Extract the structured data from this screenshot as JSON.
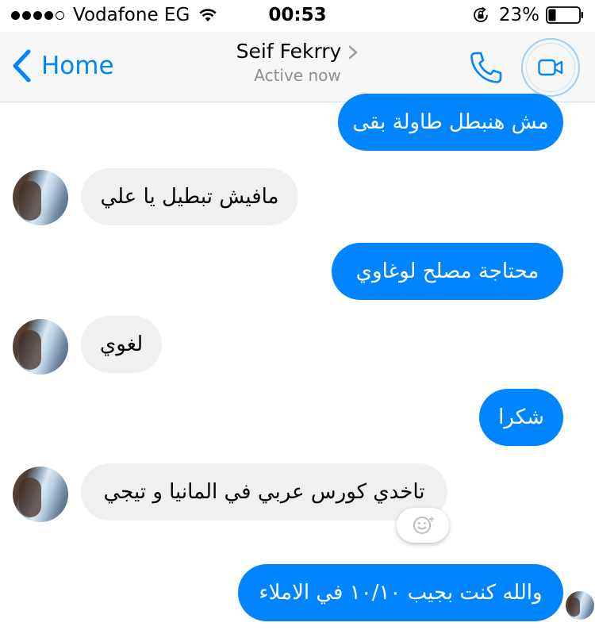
{
  "status_bar": {
    "carrier": "Vodafone EG",
    "time": "00:53",
    "battery": "23%",
    "signal_dots_filled": 4,
    "signal_dots_total": 5
  },
  "nav": {
    "back_label": "Home",
    "contact_name": "Seif Fekrry",
    "status": "Active now"
  },
  "icons": {
    "back": "chevron-left-icon",
    "phone": "phone-icon",
    "video": "video-camera-icon",
    "wifi": "wifi-icon",
    "lock": "rotation-lock-icon",
    "battery": "battery-icon",
    "reaction": "emoji-reaction-icon"
  },
  "colors": {
    "accent": "#0084ff",
    "incoming_bubble": "#f1f0f0",
    "outgoing_text": "#ffffff"
  },
  "messages": [
    {
      "direction": "out",
      "text": "مش هنبطل طاولة بقى"
    },
    {
      "direction": "in",
      "text": "مافيش تبطيل يا علي"
    },
    {
      "direction": "out",
      "text": "محتاجة مصلح لوغاوي"
    },
    {
      "direction": "in",
      "text": "لغوي"
    },
    {
      "direction": "out",
      "text": "شكرا"
    },
    {
      "direction": "in",
      "text": "تاخدي كورس عربي في المانيا و تيجي"
    },
    {
      "direction": "out",
      "text": "والله كنت بجيب ١٠/١٠ في الاملاء"
    }
  ]
}
